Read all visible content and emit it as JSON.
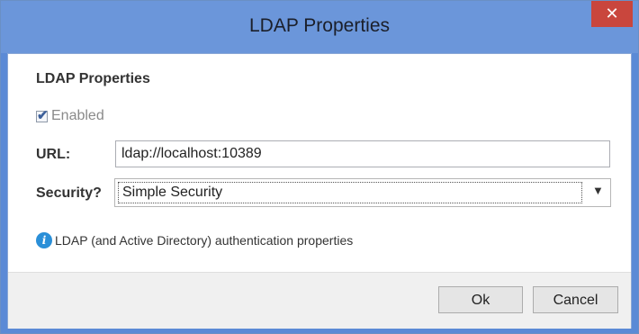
{
  "window": {
    "title": "LDAP Properties",
    "close_glyph": "✕"
  },
  "form": {
    "heading": "LDAP Properties",
    "enabled": {
      "label": "Enabled",
      "checked": true,
      "disabled": true
    },
    "url": {
      "label": "URL:",
      "value": "ldap://localhost:10389"
    },
    "security": {
      "label": "Security?",
      "selected": "Simple Security"
    },
    "info": {
      "icon": "info-icon",
      "text": "LDAP (and Active Directory) authentication properties"
    }
  },
  "buttons": {
    "ok": "Ok",
    "cancel": "Cancel"
  },
  "colors": {
    "titlebar": "#6b96da",
    "close": "#c9463d",
    "info": "#2a8fd8"
  }
}
